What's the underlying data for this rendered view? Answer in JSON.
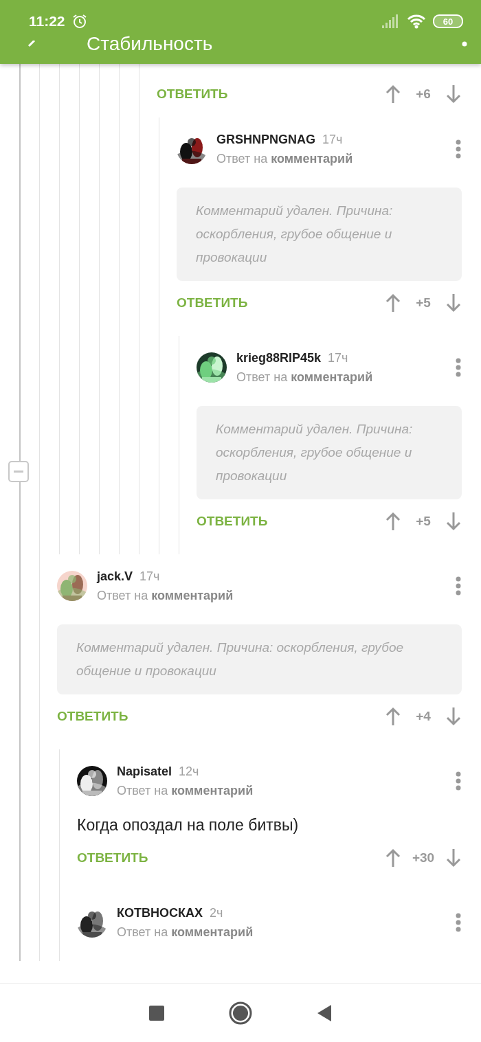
{
  "status_bar": {
    "time": "11:22",
    "battery": "60"
  },
  "header": {
    "title": "Стабильность"
  },
  "thread": [
    {
      "kind": "partial",
      "reply_label": "ОТВЕТИТЬ",
      "score": "+6",
      "children": [
        {
          "kind": "deleted",
          "author": "GRSHNPNGNAG",
          "time": "17ч",
          "reply_to": "Ответ на **комментарий**",
          "text": "Комментарий удален. Причина: оскорбления, грубое общение и провокации",
          "reply_label": "ОТВЕТИТЬ",
          "score": "+5",
          "children": [
            {
              "kind": "deleted",
              "author": "krieg88RIP45k",
              "time": "17ч",
              "reply_to": "Ответ на **комментарий**",
              "text": "Комментарий удален. Причина: оскорбления, грубое общение и провокации",
              "reply_label": "ОТВЕТИТЬ",
              "score": "+5"
            }
          ]
        }
      ]
    },
    {
      "kind": "deleted",
      "author": "jack.V",
      "time": "17ч",
      "reply_to": "Ответ на **комментарий**",
      "text": "Комментарий удален. Причина: оскорбления, грубое общение и провокации",
      "reply_label": "ОТВЕТИТЬ",
      "score": "+4",
      "children": [
        {
          "kind": "text",
          "author": "Napisatel",
          "time": "12ч",
          "reply_to": "Ответ на **комментарий**",
          "text": "Когда опоздал на поле битвы)",
          "reply_label": "ОТВЕТИТЬ",
          "score": "+30"
        },
        {
          "kind": "text",
          "author": "КОТВНОСКАХ",
          "time": "2ч",
          "reply_to": "Ответ на **комментарий**"
        }
      ]
    }
  ]
}
